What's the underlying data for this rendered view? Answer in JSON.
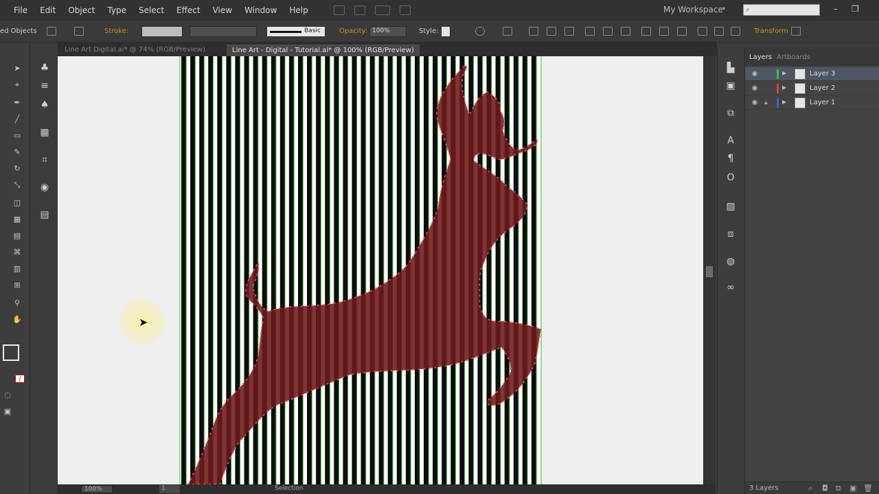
{
  "menubar": {
    "items": [
      "File",
      "Edit",
      "Object",
      "Type",
      "Select",
      "Effect",
      "View",
      "Window",
      "Help"
    ],
    "workspace": "My Workspace",
    "search_placeholder": "",
    "window_controls": [
      "–",
      "❐"
    ]
  },
  "controlbar": {
    "selection_label": "ed Objects",
    "stroke_label": "Stroke:",
    "stroke_profile": "Basic",
    "opacity_label": "Opacity:",
    "opacity_value": "100%",
    "style_label": "Style:",
    "transform_label": "Transform"
  },
  "tabs": [
    {
      "label": "Line Art Digital.ai* @ 74% (RGB/Preview)",
      "active": false
    },
    {
      "label": "Line Art - Digital - Tutorial.ai* @ 100% (RGB/Preview)",
      "active": true
    }
  ],
  "statusbar": {
    "zoom": "100%",
    "artboard": "1",
    "tool": "Selection"
  },
  "layers_panel": {
    "tabs": [
      "Layers",
      "Artboards"
    ],
    "layers": [
      {
        "name": "Layer 3",
        "color": "#3cc13c",
        "selected": true,
        "locked": false
      },
      {
        "name": "Layer 2",
        "color": "#e03a3a",
        "selected": false,
        "locked": false
      },
      {
        "name": "Layer 1",
        "color": "#3a5de0",
        "selected": false,
        "locked": true
      }
    ],
    "footer_count": "3 Layers"
  },
  "icons": {
    "eye": "eye-icon",
    "lock": "lock-icon",
    "expand": "triangle-right-icon",
    "cursor": "arrow-cursor-icon"
  }
}
